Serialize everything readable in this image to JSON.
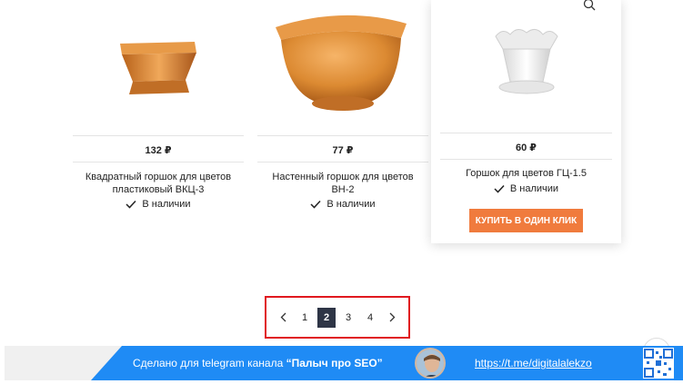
{
  "products": [
    {
      "price": "132 ₽",
      "title_line1": "Квадратный горшок для цветов",
      "title_line2": "пластиковый ВКЦ-3",
      "stock": "В наличии",
      "image_icon": "orange-square-flower-pot-image"
    },
    {
      "price": "77 ₽",
      "title_line1": "Настенный горшок для цветов",
      "title_line2": "ВН-2",
      "stock": "В наличии",
      "image_icon": "orange-wall-flower-pot-image"
    },
    {
      "price": "60 ₽",
      "title_line1": "Горшок для цветов ГЦ-1.5",
      "stock": "В наличии",
      "buy_label": "КУПИТЬ В ОДИН КЛИК",
      "image_icon": "white-flower-pot-image"
    }
  ],
  "pagination": {
    "pages": [
      "1",
      "2",
      "3",
      "4"
    ],
    "current": "2"
  },
  "banner": {
    "prefix": "Сделано для telegram канала ",
    "channel": "“Палыч про SEO”",
    "link": "https://t.me/digitalalekzo"
  },
  "colors": {
    "accent_button": "#f07b3d",
    "pagination_active": "#2e3546",
    "highlight_border": "#e0181f",
    "banner_blue": "#1f8bf5",
    "pot_orange": "#d98a2b"
  }
}
